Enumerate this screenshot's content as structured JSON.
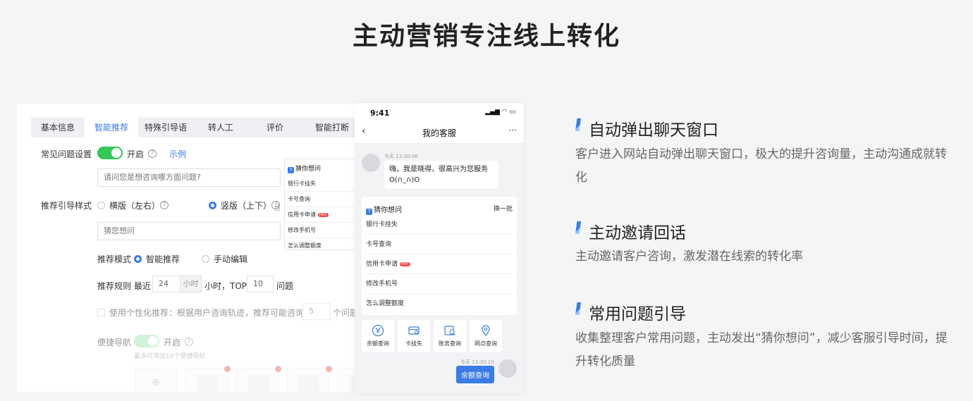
{
  "page_title": "主动营销专注线上转化",
  "admin": {
    "tabs": [
      "基本信息",
      "智能推荐",
      "特殊引导语",
      "转人工",
      "评价",
      "智能打断"
    ],
    "active_tab": 1,
    "faq_setting_label": "常见问题设置",
    "faq_toggle_label": "开启",
    "example_link": "示例",
    "faq_input_placeholder": "请问您是想咨询哪方面问题?",
    "style_label": "推荐引导样式",
    "style_horizontal": "横版（左右）",
    "style_vertical": "竖版（上下）",
    "guess_input_value": "猜您想问",
    "mode_label": "推荐模式",
    "mode_smart": "智能推荐",
    "mode_manual": "手动编辑",
    "rule_label": "推荐规则",
    "rule_recent": "最近",
    "rule_hours_value": "24",
    "rule_hours_unit": "小时",
    "rule_top_text": "小时，TOP",
    "rule_top_value": "10",
    "rule_questions": "问题",
    "personalized_text": "使用个性化推荐：根据用户咨询轨迹，推荐可能咨询的",
    "personalized_value": "5",
    "personalized_suffix": "个问题",
    "shortcut_label": "便捷导航",
    "shortcut_toggle_label": "开启",
    "shortcut_hint": "最多可添加10个便捷导航",
    "preview": {
      "header": "猜你想问",
      "items": [
        "银行卡挂失",
        "卡号查询",
        "信用卡申请",
        "修改手机号",
        "怎么调整额度"
      ],
      "hot_badge": "HOT"
    }
  },
  "phone": {
    "time": "9:41",
    "status_icons": "▂▄▆ ◠ ▭",
    "nav_title": "我的客服",
    "nav_more": "···",
    "msg_timestamp": "今天 13:30:06",
    "greeting_line1": "嗨，我是晓得，很高兴为您服务",
    "greeting_line2": "O(∩_∩)O",
    "guess_header": "猜你想问",
    "guess_swap": "换一批",
    "guess_items": [
      "银行卡挂失",
      "卡号查询",
      "信用卡申请",
      "修改手机号",
      "怎么调整额度"
    ],
    "hot_badge": "HOT",
    "quick_actions": [
      {
        "label": "余额查询",
        "icon": "yen-icon"
      },
      {
        "label": "卡挂失",
        "icon": "card-icon"
      },
      {
        "label": "账务查询",
        "icon": "bill-search-icon"
      },
      {
        "label": "网点查询",
        "icon": "location-icon"
      }
    ],
    "sent_timestamp": "今天 13:30:10",
    "sent_message": "余额查询"
  },
  "features": [
    {
      "title": "自动弹出聊天窗口",
      "desc": "客户进入网站自动弹出聊天窗口，极大的提升咨询量，主动沟通成就转化"
    },
    {
      "title": "主动邀请回话",
      "desc": "主动邀请客户咨询，激发潜在线索的转化率"
    },
    {
      "title": "常用问题引导",
      "desc": "收集整理客户常用问题，主动发出“猜你想问”，减少客服引导时间，提升转化质量"
    }
  ],
  "colors": {
    "accent": "#3a7be6",
    "toggle_on": "#34c759",
    "hot": "#f04a4a"
  }
}
